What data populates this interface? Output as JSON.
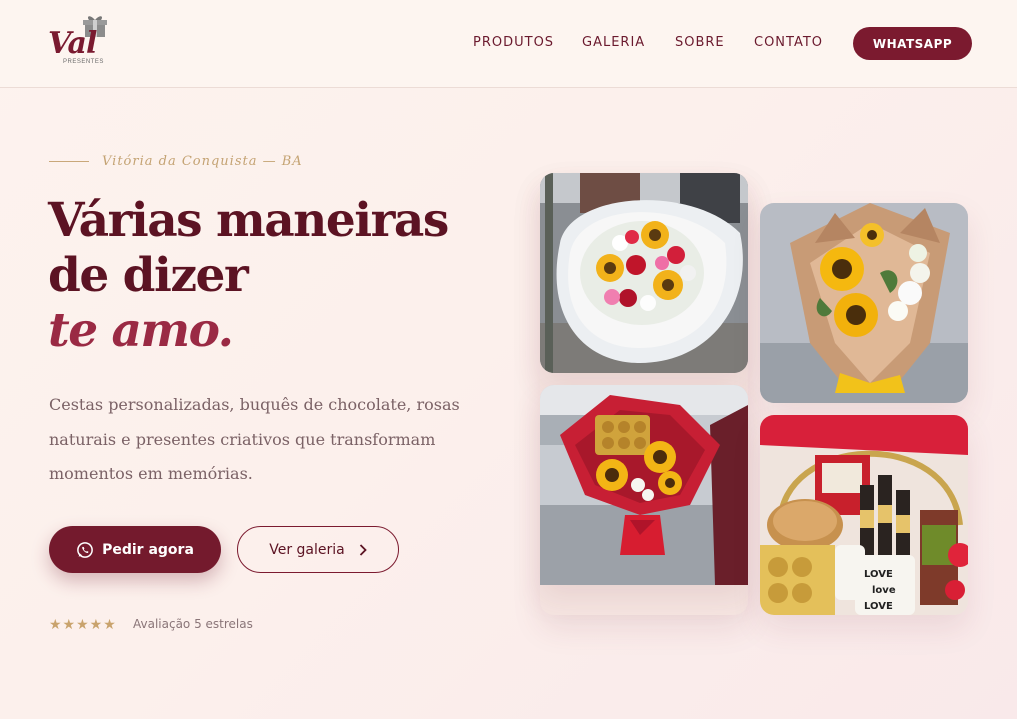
{
  "brand": {
    "logo_text": "Val",
    "logo_subtitle": "PRESENTES"
  },
  "nav": {
    "items": [
      "PRODUTOS",
      "GALERIA",
      "SOBRE",
      "CONTATO"
    ],
    "cta_label": "WHATSAPP"
  },
  "hero": {
    "eyebrow": "Vitória da Conquista — BA",
    "title_line1": "Várias maneiras",
    "title_line2": "de dizer",
    "title_line3": "te amo.",
    "description_lines": [
      "Cestas personalizadas, buquês de chocolate, rosas",
      "naturais e presentes criativos que transformam",
      "momentos em memórias."
    ],
    "primary_button": "Pedir agora",
    "secondary_button": "Ver galeria",
    "stars": "★★★★★",
    "rating_label": "Avaliação 5 estrelas"
  },
  "gallery": {
    "items": [
      "sunflower-rose-bouquet-photo",
      "sunflower-kraft-bouquet-photo",
      "chocolate-sunflower-bouquet-photo",
      "gift-basket-photo"
    ]
  },
  "colors": {
    "primary": "#7b1a2f",
    "accent_gold": "#c4a373",
    "background": "#fdf3ee"
  }
}
